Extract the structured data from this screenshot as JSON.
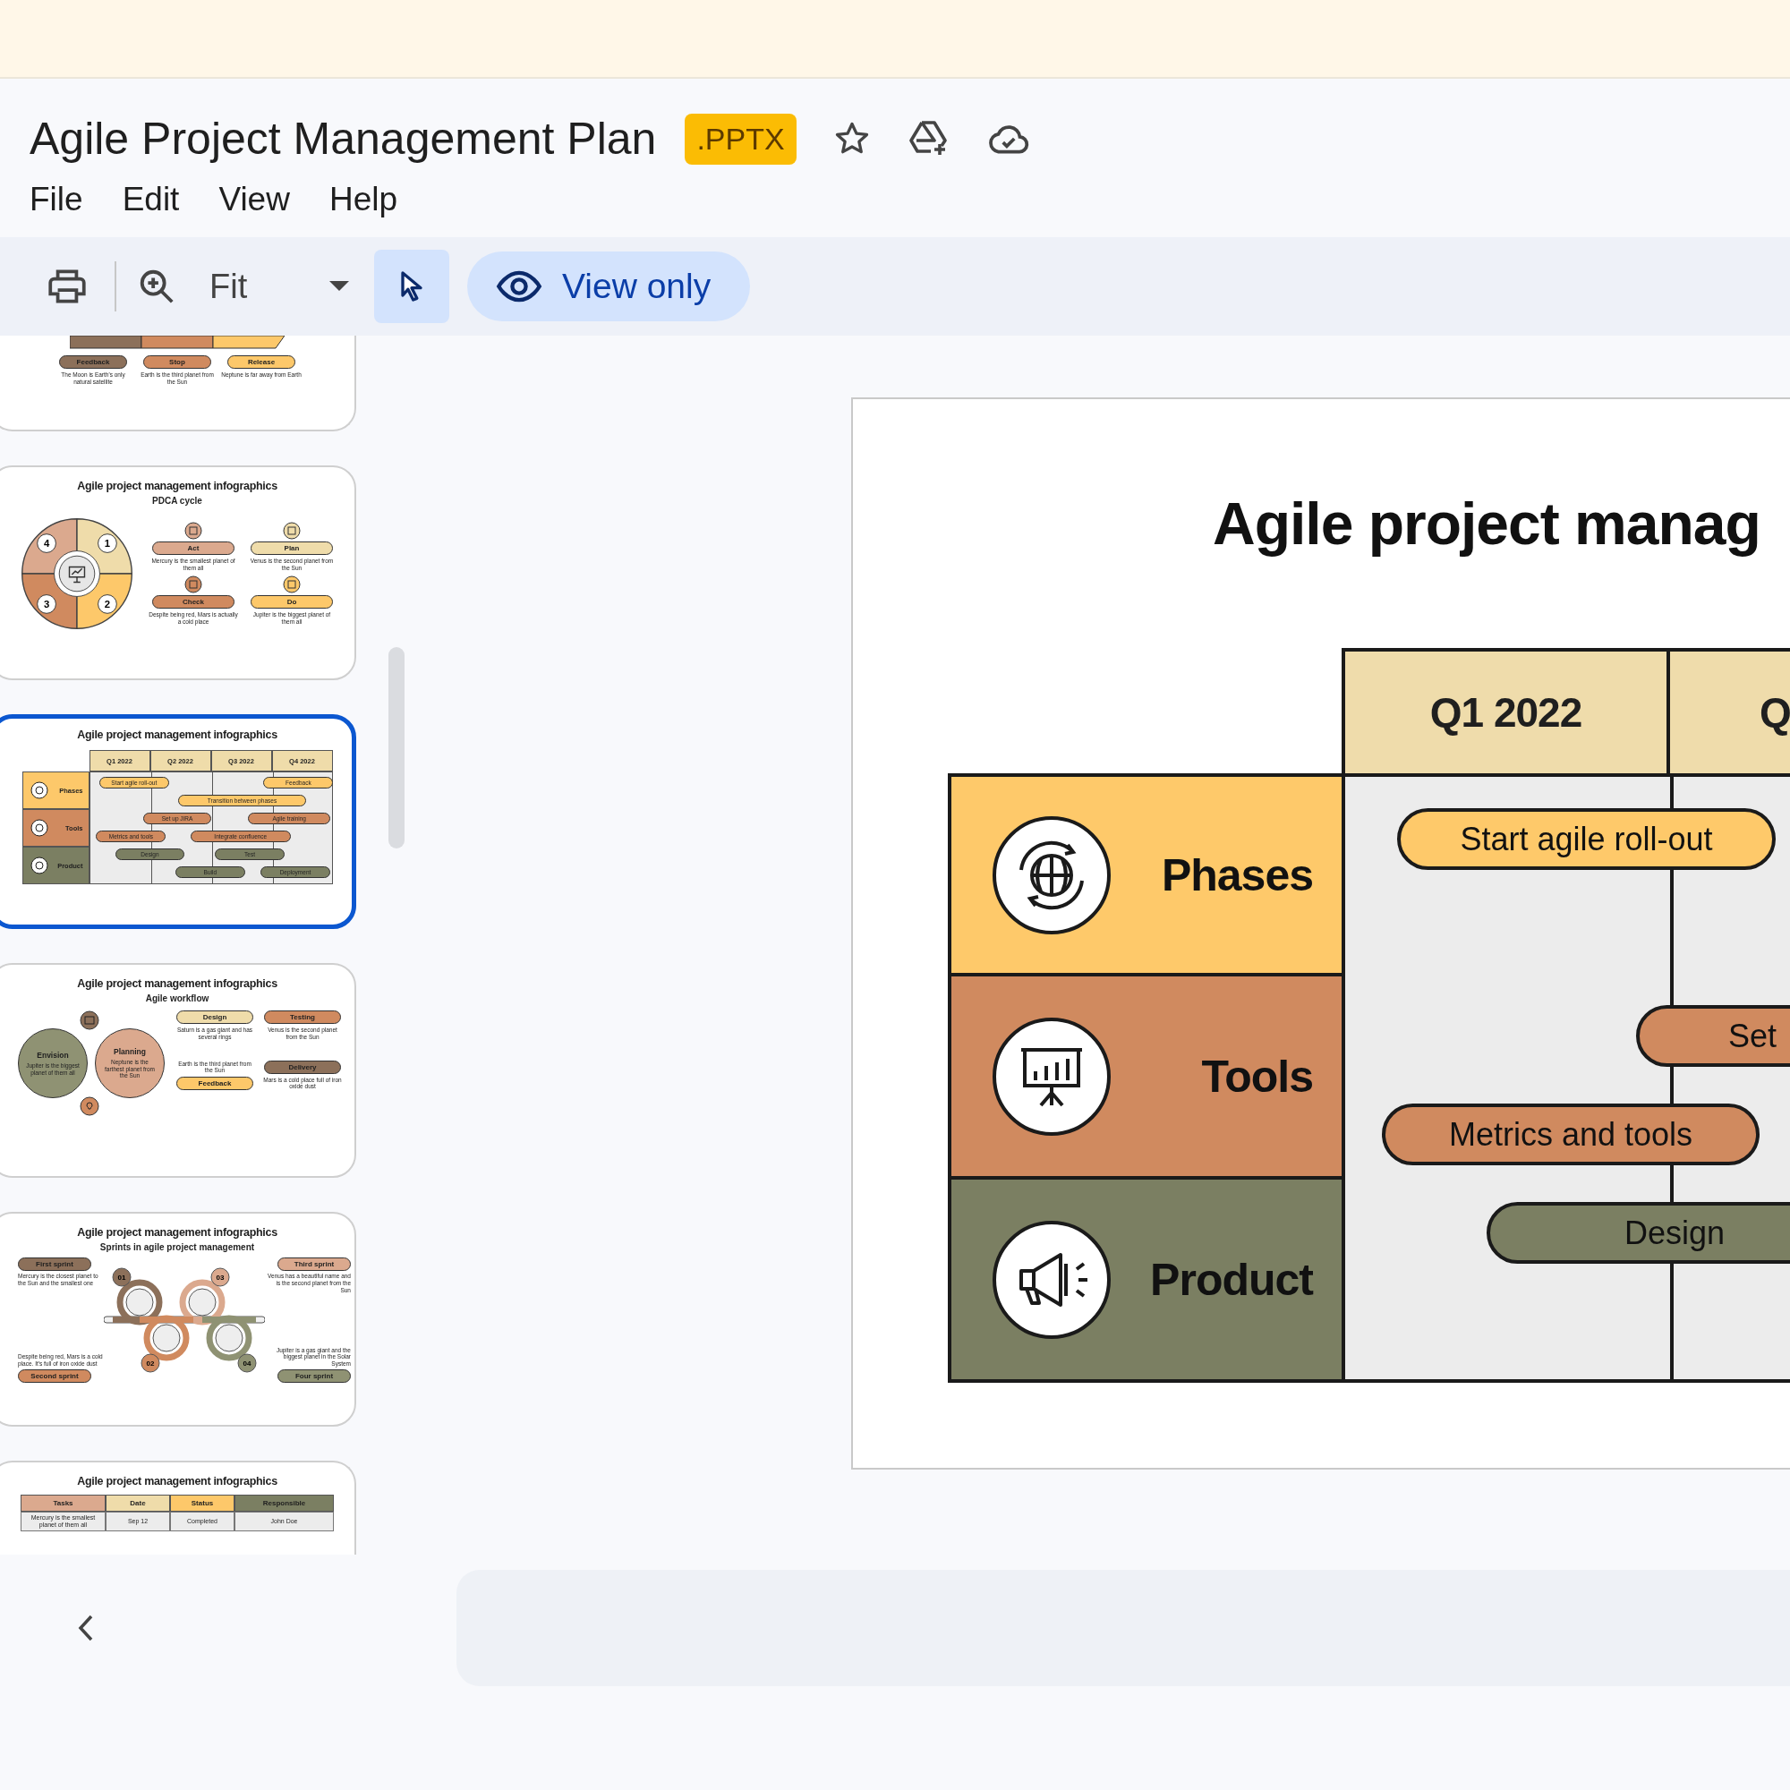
{
  "document": {
    "title": "Agile Project Management Plan",
    "badge": ".PPTX"
  },
  "menu": [
    "File",
    "Edit",
    "View",
    "Help"
  ],
  "toolbar": {
    "zoom": "Fit",
    "pointer_selected": true,
    "view_mode": "View only"
  },
  "thumbnails": [
    {
      "kind": "steps",
      "selected": false,
      "steps": [
        {
          "label": "Feedback",
          "text": "The Moon is Earth's only natural satellite",
          "color": "#8c705a"
        },
        {
          "label": "Stop",
          "text": "Earth is the third planet from the Sun",
          "color": "#d08a5f"
        },
        {
          "label": "Release",
          "text": "Neptune is far away from Earth",
          "color": "#fdc86a"
        }
      ]
    },
    {
      "kind": "pdca",
      "selected": false,
      "title": "Agile project management infographics",
      "subtitle": "PDCA cycle",
      "items": [
        {
          "number": "4",
          "label": "Act",
          "text": "Mercury is the smallest planet of them all",
          "color": "#dba98e"
        },
        {
          "number": "1",
          "label": "Plan",
          "text": "Venus is the second planet from the Sun",
          "color": "#efdcaa"
        },
        {
          "number": "3",
          "label": "Check",
          "text": "Despite being red, Mars is actually a cold place",
          "color": "#d08a5f"
        },
        {
          "number": "2",
          "label": "Do",
          "text": "Jupiter is the biggest planet of them all",
          "color": "#fdc86a"
        }
      ]
    },
    {
      "kind": "gantt",
      "selected": true,
      "title": "Agile project management infographics",
      "quarters": [
        "Q1 2022",
        "Q2 2022",
        "Q3 2022",
        "Q4 2022"
      ],
      "rows": [
        {
          "label": "Phases",
          "color": "#fdc86a",
          "bars": [
            "Start agile roll-out",
            "Feedback",
            "Transition between phases"
          ]
        },
        {
          "label": "Tools",
          "color": "#d08a5f",
          "bars": [
            "Set up JIRA",
            "Agile training",
            "Metrics and tools",
            "Integrate confluence"
          ]
        },
        {
          "label": "Product",
          "color": "#7b7f62",
          "bars": [
            "Design",
            "Test",
            "Build",
            "Deployment"
          ]
        }
      ]
    },
    {
      "kind": "workflow",
      "selected": false,
      "title": "Agile project management infographics",
      "subtitle": "Agile workflow",
      "circles": [
        {
          "label": "Envision",
          "text": "Jupiter is the biggest planet of them all",
          "color": "#8f9273"
        },
        {
          "label": "Planning",
          "text": "Neptune is the farthest planet from the Sun",
          "color": "#dba98e"
        }
      ],
      "steps": [
        {
          "label": "Design",
          "text": "Saturn is a gas giant and has several rings",
          "color": "#efdcaa"
        },
        {
          "label": "Testing",
          "text": "Venus is the second planet from the Sun",
          "color": "#d08a5f"
        },
        {
          "label": "Feedback",
          "text": "Earth is the third planet from the Sun",
          "color": "#fdc86a"
        },
        {
          "label": "Delivery",
          "text": "Mars is a cold place full of iron oxide dust",
          "color": "#8c705a"
        }
      ]
    },
    {
      "kind": "sprints",
      "selected": false,
      "title": "Agile project management infographics",
      "subtitle": "Sprints in agile project management",
      "sprints": [
        {
          "label": "First sprint",
          "number": "01",
          "text": "Mercury is the closest planet to the Sun and the smallest one",
          "color": "#8c705a"
        },
        {
          "label": "Third sprint",
          "number": "03",
          "text": "Venus has a beautiful name and is the second planet from the Sun",
          "color": "#dba98e"
        },
        {
          "label": "Second sprint",
          "number": "02",
          "text": "Despite being red, Mars is a cold place. It's full of iron oxide dust",
          "color": "#d08a5f"
        },
        {
          "label": "Four sprint",
          "number": "04",
          "text": "Jupiter is a gas giant and the biggest planet in the Solar System",
          "color": "#8f9273"
        }
      ]
    },
    {
      "kind": "table",
      "selected": false,
      "title": "Agile project management infographics",
      "columns": [
        {
          "label": "Tasks",
          "color": "#dba98e"
        },
        {
          "label": "Date",
          "color": "#efdcaa"
        },
        {
          "label": "Status",
          "color": "#fdc86a"
        },
        {
          "label": "Responsible",
          "color": "#7b7f62"
        }
      ],
      "rows": [
        [
          "Mercury is the smallest planet of them all",
          "Sep 12",
          "Completed",
          "John Doe"
        ]
      ]
    }
  ],
  "slide": {
    "title": "Agile project manag",
    "quarters": [
      "Q1 2022",
      "Q"
    ],
    "rows": [
      {
        "label": "Phases",
        "color": "#fec96a",
        "bars": [
          "Start agile roll-out"
        ]
      },
      {
        "label": "Tools",
        "color": "#d08a5f",
        "bars": [
          "Set",
          "Metrics and tools"
        ]
      },
      {
        "label": "Product",
        "color": "#7b7f62",
        "bars": [
          "Design"
        ]
      }
    ]
  }
}
